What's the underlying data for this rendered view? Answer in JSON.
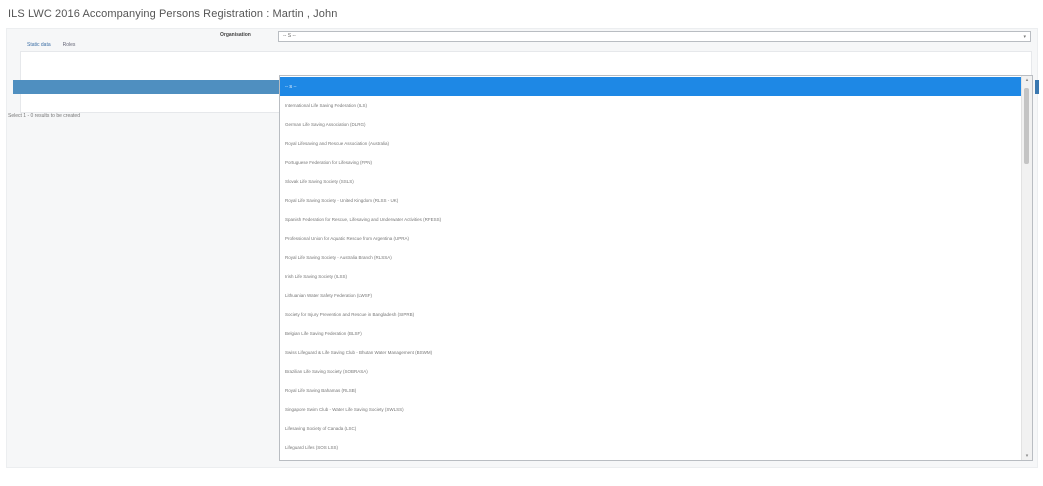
{
  "page": {
    "title": "ILS LWC 2016 Accompanying Persons Registration : Martin , John"
  },
  "tabs": [
    {
      "label": "Static data",
      "active": true
    },
    {
      "label": "Roles",
      "active": false
    }
  ],
  "form": {
    "organisation_label": "Organisation",
    "organisation_value": "-- S --"
  },
  "status_text": "Select 1 - 0 results to be created",
  "dropdown": {
    "options": [
      "-- S --",
      "International Life Saving Federation (ILS)",
      "German Life Saving Association (DLRG)",
      "Royal Lifesaving and Rescue Association (Australia)",
      "Portuguese Federation for Lifesaving (FPN)",
      "Slovak Life Saving Society (SSLS)",
      "Royal Life Saving Society - United Kingdom (RLSS - UK)",
      "Spanish Federation for Rescue, Lifesaving and Underwater Activities (RFESS)",
      "Professional Union for Aquatic Rescue from Argentina (UPRA)",
      "Royal Life Saving Society - Australia Branch (RLSSA)",
      "Irish Life Saving Society (ILSS)",
      "Lithuanian Water Safety Federation (LWSF)",
      "Society for Injury Prevention and Rescue in Bangladesh (SIPRB)",
      "Belgian Life Saving Federation (BLSF)",
      "Swiss Lifeguard & Life Saving Club - Bhutan Water Management (BSWM)",
      "Brazilian Life Saving Society (SOBRASA)",
      "Royal Life Saving Bahamas (RLSB)",
      "Singapore Swim Club - Water Life Saving Society (SWLSS)",
      "Lifesaving Society of Canada (LSC)",
      "Lifeguard Lifes (SOS LSS)"
    ]
  },
  "colors": {
    "highlight": "#1e88e5",
    "bar": "#4f8fc0",
    "tab_accent": "#3b8fd6"
  },
  "icons": {
    "select_caret": "▾",
    "scroll_up": "▴",
    "scroll_down": "▾"
  }
}
